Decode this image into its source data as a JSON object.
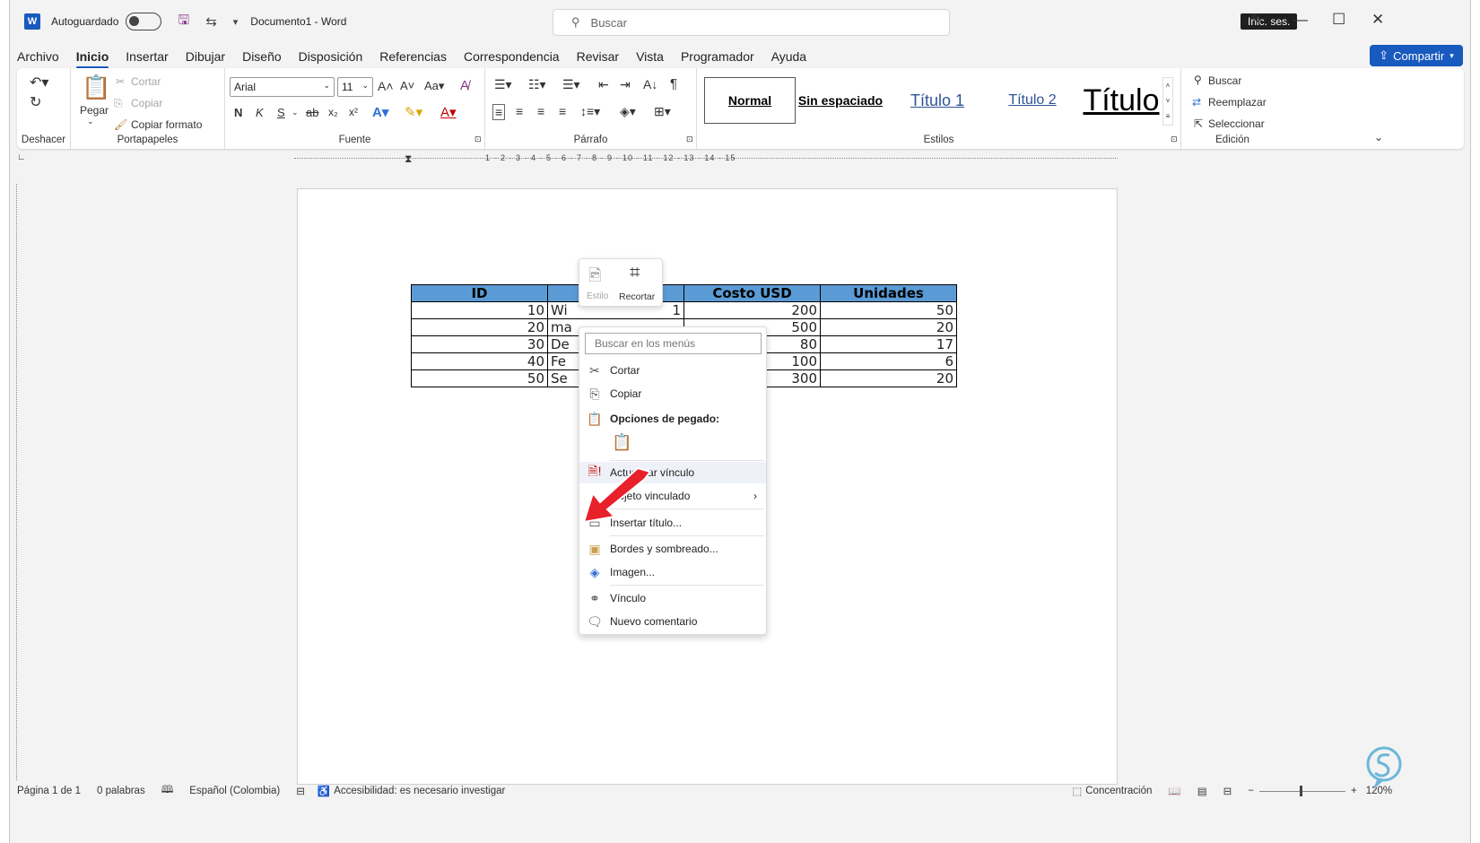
{
  "titlebar": {
    "autosave": "Autoguardado",
    "document": "Documento1  -  Word",
    "search": "Buscar",
    "signin": "Inic. ses."
  },
  "tabs": [
    "Archivo",
    "Inicio",
    "Insertar",
    "Dibujar",
    "Diseño",
    "Disposición",
    "Referencias",
    "Correspondencia",
    "Revisar",
    "Vista",
    "Programador",
    "Ayuda"
  ],
  "share": "Compartir",
  "ribbon": {
    "undo_group": "Deshacer",
    "clipboard": {
      "label": "Portapapeles",
      "paste": "Pegar",
      "cut": "Cortar",
      "copy": "Copiar",
      "format_painter": "Copiar formato"
    },
    "font": {
      "label": "Fuente",
      "family": "Arial",
      "size": "11",
      "bold": "N",
      "italic": "K",
      "underline": "S"
    },
    "paragraph": {
      "label": "Párrafo"
    },
    "styles": {
      "label": "Estilos",
      "items": [
        "Normal",
        "Sin espaciado",
        "Título 1",
        "Título 2",
        "Título"
      ]
    },
    "editing": {
      "label": "Edición",
      "find": "Buscar",
      "replace": "Reemplazar",
      "select": "Seleccionar"
    }
  },
  "ruler_numbers": "1 · 2 · 3 · 4 · 5 · 6 · 7 · 8 · 9 · 10 · 11 · 12 · 13 · 14 · 15",
  "table": {
    "headers": [
      "ID",
      "",
      "Costo USD",
      "Unidades"
    ],
    "rows": [
      [
        "10",
        "Wi",
        "1",
        "200",
        "50"
      ],
      [
        "20",
        "ma",
        "",
        "500",
        "20"
      ],
      [
        "30",
        "De",
        "",
        "80",
        "17"
      ],
      [
        "40",
        "Fe",
        "",
        "100",
        "6"
      ],
      [
        "50",
        "Se",
        "",
        "300",
        "20"
      ]
    ]
  },
  "minitoolbar": {
    "style": "Estilo",
    "crop": "Recortar"
  },
  "context_menu": {
    "search_placeholder": "Buscar en los menús",
    "items": [
      "Cortar",
      "Copiar",
      "Opciones de pegado:",
      "Actualizar vínculo",
      "Objeto  vinculado",
      "Insertar título...",
      "Bordes y sombreado...",
      "Imagen...",
      "Vínculo",
      "Nuevo comentario"
    ]
  },
  "status": {
    "page": "Página 1 de 1",
    "words": "0 palabras",
    "language": "Español (Colombia)",
    "accessibility": "Accesibilidad: es necesario investigar",
    "focus": "Concentración",
    "zoom": "120%"
  },
  "colors": {
    "accent": "#185abd",
    "table_header": "#5b9bd5",
    "arrow": "#e8202a"
  }
}
